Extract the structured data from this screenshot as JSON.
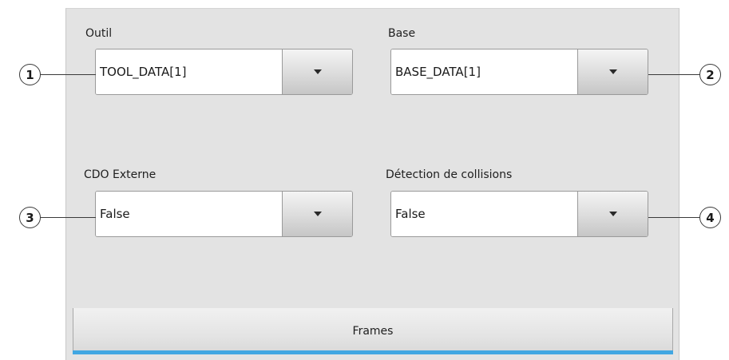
{
  "fields": [
    {
      "label": "Outil",
      "value": "TOOL_DATA[1]",
      "callout": "1"
    },
    {
      "label": "Base",
      "value": "BASE_DATA[1]",
      "callout": "2"
    },
    {
      "label": "CDO Externe",
      "value": "False",
      "callout": "3"
    },
    {
      "label": "Détection de collisions",
      "value": "False",
      "callout": "4"
    }
  ],
  "tab": {
    "label": "Frames"
  },
  "colors": {
    "panel_background": "#e3e3e3",
    "tab_accent": "#41a7e2",
    "callout_border": "#3a3a3a"
  },
  "icons": {
    "dropdown": "triangle-down-icon"
  }
}
